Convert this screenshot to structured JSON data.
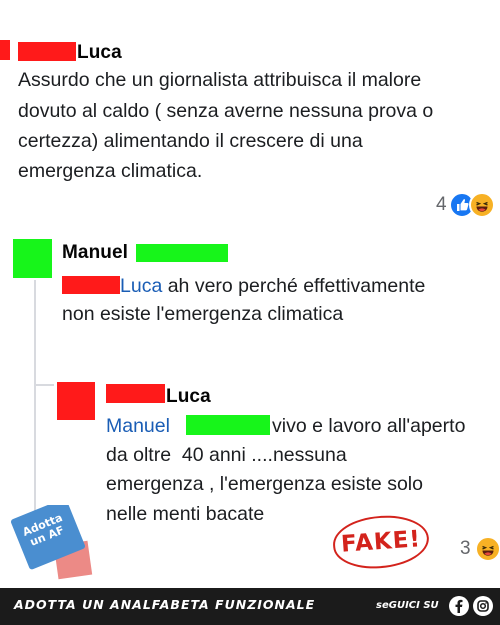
{
  "comment1": {
    "author": "Luca",
    "lines": [
      "Assurdo che un giornalista attribuisca il malore",
      "dovuto al caldo ( senza averne nessuna prova o",
      "certezza) alimentando il crescere di una",
      "emergenza climatica."
    ],
    "reaction_count": "4"
  },
  "comment2": {
    "author": "Manuel",
    "mention": "Luca",
    "line1_rest": " ah vero perché effettivamente",
    "line2": "non esiste l'emergenza climatica"
  },
  "comment3": {
    "author": "Luca",
    "mention": "Manuel",
    "line1_rest": "vivo e lavoro all'aperto",
    "lines": [
      "da oltre  40 anni ....nessuna",
      "emergenza , l'emergenza esiste solo",
      "nelle menti bacate"
    ],
    "reaction_count": "3"
  },
  "stamp": "FAKE!",
  "badge": "Adotta un AF",
  "footer": {
    "title": "ADOTTA UN ANALFABETA FUNZIONALE",
    "follow": "seGUICI SU"
  },
  "icons": {
    "like": "like-icon",
    "haha": "haha-icon",
    "facebook": "facebook-icon",
    "instagram": "instagram-icon"
  },
  "colors": {
    "redaction_red": "#ff1a1a",
    "redaction_green": "#17f51a",
    "mention_blue": "#1a5db5",
    "stamp_red": "#d3231c"
  }
}
